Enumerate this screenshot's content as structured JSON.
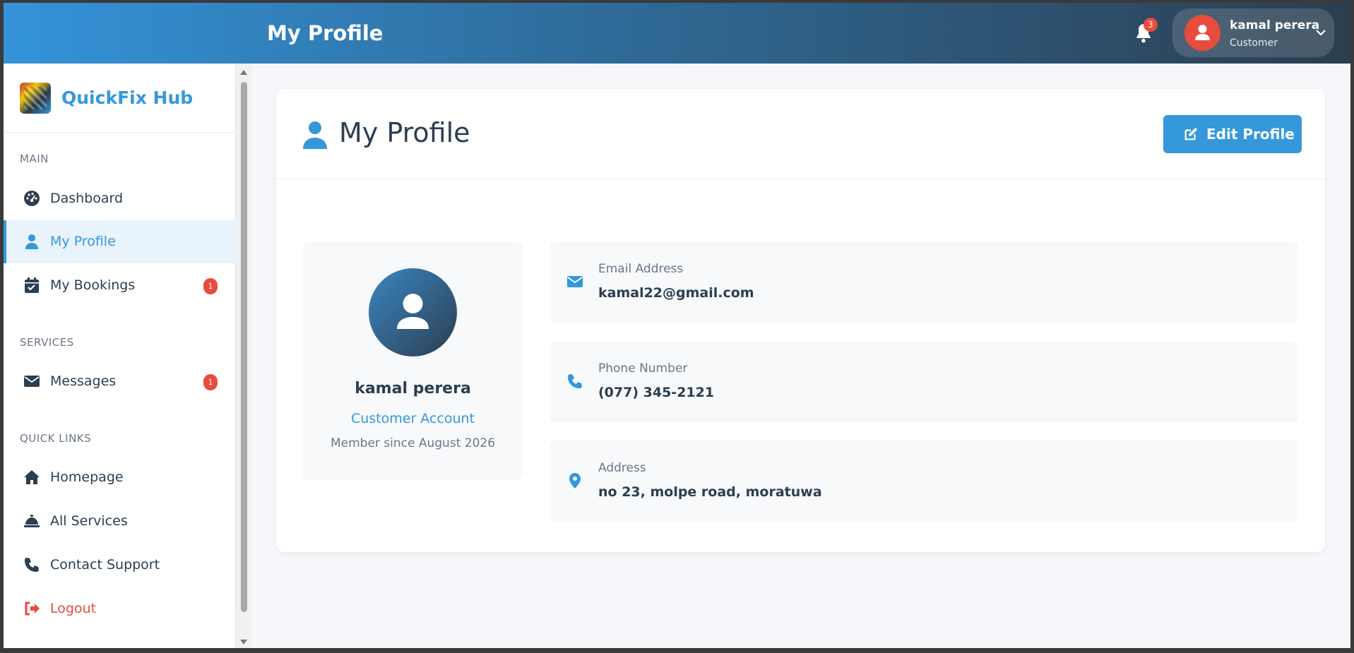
{
  "topbar": {
    "title": "My Profile",
    "notifications_count": "3",
    "user": {
      "name": "kamal perera",
      "role": "Customer"
    }
  },
  "sidebar": {
    "brand": "QuickFix Hub",
    "sections": {
      "main": "MAIN",
      "services": "SERVICES",
      "quick_links": "QUICK LINKS"
    },
    "items": {
      "dashboard": "Dashboard",
      "my_profile": "My Profile",
      "my_bookings": "My Bookings",
      "my_bookings_badge": "1",
      "messages": "Messages",
      "messages_badge": "1",
      "homepage": "Homepage",
      "all_services": "All Services",
      "contact_support": "Contact Support",
      "logout": "Logout"
    }
  },
  "main": {
    "title": "My Profile",
    "edit_button": "Edit Profile",
    "profile": {
      "name": "kamal perera",
      "account_type": "Customer Account",
      "member_since": "Member since August 2026"
    },
    "info": {
      "email_label": "Email Address",
      "email_value": "kamal22@gmail.com",
      "phone_label": "Phone Number",
      "phone_value": "(077) 345-2121",
      "address_label": "Address",
      "address_value": "no 23, molpe road, moratuwa"
    }
  },
  "colors": {
    "accent": "#3498db",
    "dark": "#2c3e50",
    "danger": "#e74c3c"
  }
}
